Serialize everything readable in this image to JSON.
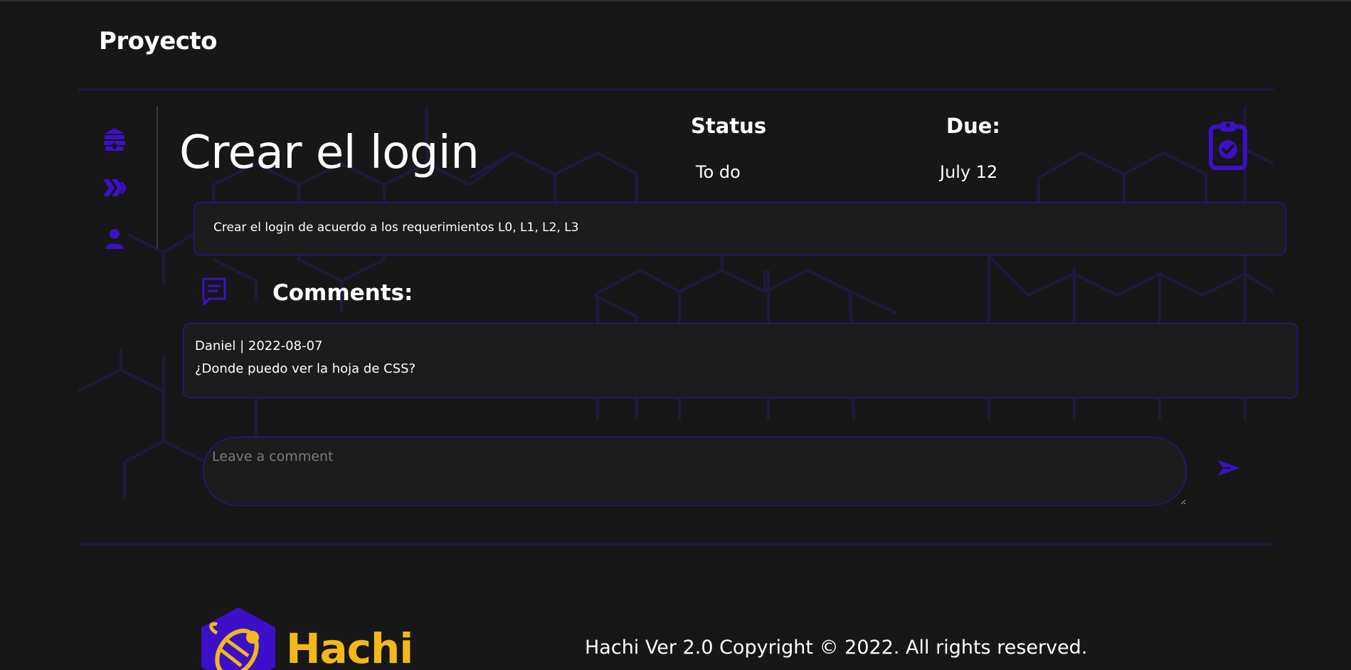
{
  "app": {
    "brand_title": "Proyecto"
  },
  "colors": {
    "background": "#171717",
    "accent": "#3513b0",
    "icon_accent": "#3c10c8",
    "brand_yellow": "#f2b818",
    "card_background": "#1c1c1c"
  },
  "sidebar": {
    "items": [
      {
        "icon": "beehive-icon",
        "label": "Home"
      },
      {
        "icon": "hive-chevrons-icon",
        "label": "Hive"
      },
      {
        "icon": "user-icon",
        "label": "Profile"
      }
    ]
  },
  "task": {
    "title": "Crear el login",
    "status_label": "Status",
    "status_value": "To do",
    "due_label": "Due:",
    "due_value": "July 12",
    "badge_icon": "clipboard-check-icon",
    "description": "Crear el login de acuerdo a los requerimientos L0, L1, L2, L3"
  },
  "comments": {
    "heading": "Comments:",
    "icon": "comment-icon",
    "items": [
      {
        "meta": "Daniel | 2022-08-07",
        "body": "¿Donde puedo ver la hoja de CSS?"
      }
    ],
    "input_placeholder": "Leave a comment",
    "send_icon": "send-plane-icon"
  },
  "footer": {
    "logo_icon": "bee-hexagon-logo-icon",
    "brand": "Hachi",
    "copyright": "Hachi Ver 2.0 Copyright © 2022. All rights reserved."
  }
}
